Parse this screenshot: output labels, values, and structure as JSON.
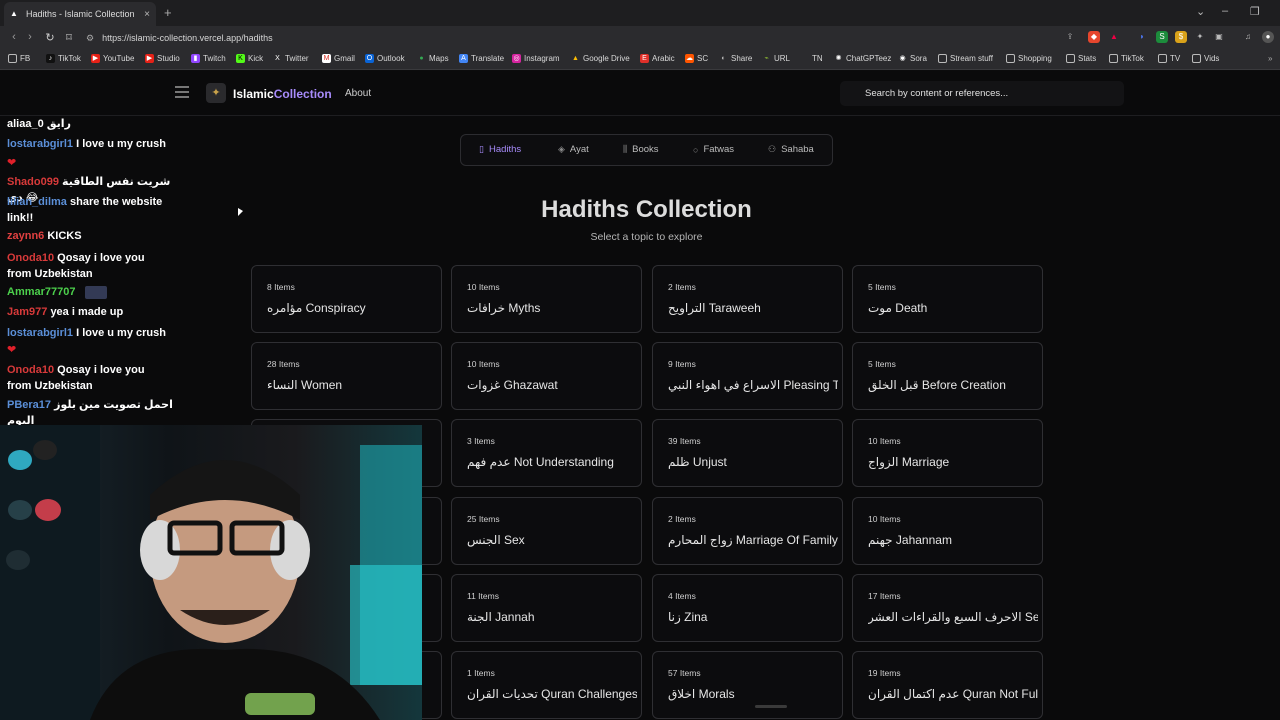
{
  "browser": {
    "tab_title": "Hadiths - Islamic Collection",
    "tab_close": "×",
    "new_tab": "+",
    "url": "https://islamic-collection.vercel.app/hadiths",
    "bookmarks": [
      "FB",
      "TikTok",
      "YouTube",
      "Studio",
      "Twitch",
      "Kick",
      "Twitter",
      "Gmail",
      "Outlook",
      "Maps",
      "Translate",
      "Instagram",
      "Google Drive",
      "Arabic",
      "SC",
      "Share",
      "URL",
      "TN",
      "ChatGPTeez",
      "Sora",
      "Stream stuff",
      "Shopping",
      "Stats",
      "TikTok",
      "TV",
      "Vids"
    ]
  },
  "site": {
    "logo_a": "Islamic",
    "logo_b": "Collection",
    "nav_about": "About",
    "search_placeholder": "Search by content or references...",
    "tabs": [
      "Hadiths",
      "Ayat",
      "Books",
      "Fatwas",
      "Sahaba"
    ],
    "active_tab": "Hadiths",
    "title": "Hadiths Collection",
    "subtitle": "Select a topic to explore",
    "cards": [
      {
        "count": "8 Items",
        "name": "مؤامره Conspiracy"
      },
      {
        "count": "10 Items",
        "name": "خرافات Myths"
      },
      {
        "count": "2 Items",
        "name": "التراويح Taraweeh"
      },
      {
        "count": "5 Items",
        "name": "موت Death"
      },
      {
        "count": "28 Items",
        "name": "النساء Women"
      },
      {
        "count": "10 Items",
        "name": "غزوات Ghazawat"
      },
      {
        "count": "9 Items",
        "name": "الاسراع في اهواء النبي Pleasing T..."
      },
      {
        "count": "5 Items",
        "name": "قبل الخلق Before Creation"
      },
      {
        "count": "3 Items",
        "name": "عدم فهم Not Understanding"
      },
      {
        "count": "39 Items",
        "name": "ظلم Unjust"
      },
      {
        "count": "10 Items",
        "name": "الزواج Marriage"
      },
      {
        "count": "25 Items",
        "name": "الجنس Sex"
      },
      {
        "count": "2 Items",
        "name": "زواج المحارم Marriage Of Family"
      },
      {
        "count": "10 Items",
        "name": "جهنم Jahannam"
      },
      {
        "count": "11 Items",
        "name": "الجنة Jannah"
      },
      {
        "count": "4 Items",
        "name": "زنا Zina"
      },
      {
        "count": "17 Items",
        "name": "الاحرف السبع والقراءات العشر Seve..."
      },
      {
        "count": "1 Items",
        "name": "تحديات القران Quran Challenges"
      },
      {
        "count": "57 Items",
        "name": "اخلاق Morals"
      },
      {
        "count": "19 Items",
        "name": "عدم اكتمال القران Quran Not Full"
      }
    ]
  },
  "chat": [
    {
      "user": "aliaa_0",
      "color": "#ffffff",
      "text": "رايق"
    },
    {
      "user": "lostarabgirl1",
      "color": "#5b8fd8",
      "text": "I love u my crush"
    },
    {
      "user": "",
      "color": "#e0202a",
      "text": "❤"
    },
    {
      "user": "Shado099",
      "color": "#d83a3a",
      "text": "شريت نفس الطاقية دي 😂"
    },
    {
      "user": "lilian_dilma",
      "color": "#5b8fd8",
      "text": "share the website"
    },
    {
      "user": "",
      "color": "#ffffff",
      "text": "link!!"
    },
    {
      "user": "zaynn6",
      "color": "#e04040",
      "text": "KICKS"
    },
    {
      "user": "Onoda10",
      "color": "#d83a3a",
      "text": "Qosay i love you"
    },
    {
      "user": "",
      "color": "#ffffff",
      "text": "from Uzbekistan"
    },
    {
      "user": "Ammar77707",
      "color": "#4cd04c",
      "text": ""
    },
    {
      "user": "Jam977",
      "color": "#d83a3a",
      "text": "yea i made up"
    },
    {
      "user": "lostarabgirl1",
      "color": "#5b8fd8",
      "text": "I love u my crush"
    },
    {
      "user": "",
      "color": "#e0202a",
      "text": "❤"
    },
    {
      "user": "Onoda10",
      "color": "#d83a3a",
      "text": "Qosay i love you"
    },
    {
      "user": "",
      "color": "#ffffff",
      "text": "from Uzbekistan"
    },
    {
      "user": "PBera17",
      "color": "#5b8fd8",
      "text": "احمل تصويت مين بلوز اليوم"
    }
  ]
}
